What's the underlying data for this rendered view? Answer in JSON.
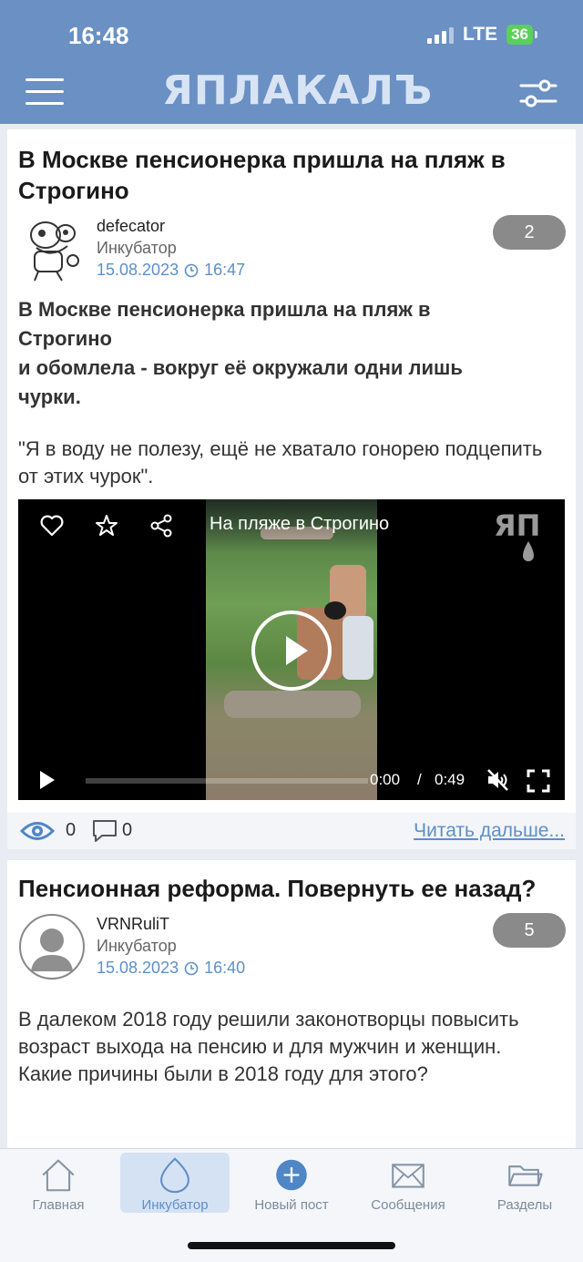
{
  "status_bar": {
    "time": "16:48",
    "network": "LTE",
    "battery": "36"
  },
  "header": {
    "logo": "ЯПЛАКАЛЪ"
  },
  "posts": [
    {
      "title": "В Москве пенсионерка пришла на пляж в Строгино",
      "author": "defecator",
      "section": "Инкубатор",
      "date": "15.08.2023",
      "time": "16:47",
      "rating": "2",
      "body_bold": "В Москве пенсионерка пришла на пляж в Строгино\nи обомлела - вокруг её окружали одни лишь чурки.",
      "body_quote": "\"Я в воду не полезу, ещё не хватало гонорею подцепить от этих чурок\".",
      "video": {
        "title": "На пляже в Строгино",
        "current_time": "0:00",
        "separator": "/",
        "duration": "0:49",
        "watermark": "ЯП"
      },
      "views": "0",
      "comments": "0",
      "read_more": "Читать дальше..."
    },
    {
      "title": "Пенсионная реформа. Повернуть ее назад?",
      "author": "VRNRuliT",
      "section": "Инкубатор",
      "date": "15.08.2023",
      "time": "16:40",
      "rating": "5",
      "body": "В далеком 2018 году решили законотворцы повысить возраст выхода на пенсию и для мужчин и женщин.\nКакие причины были в 2018 году для этого?"
    }
  ],
  "tabbar": {
    "tabs": [
      {
        "label": "Главная",
        "icon": "home-icon",
        "active": false
      },
      {
        "label": "Инкубатор",
        "icon": "egg-icon",
        "active": true
      },
      {
        "label": "Новый пост",
        "icon": "plus-circle-icon",
        "active": false
      },
      {
        "label": "Сообщения",
        "icon": "envelope-icon",
        "active": false
      },
      {
        "label": "Разделы",
        "icon": "folder-icon",
        "active": false
      }
    ]
  },
  "colors": {
    "header": "#6a90c4",
    "accent": "#5d8fc9",
    "badge": "#8a8a8a",
    "battery": "#5ad05a"
  }
}
